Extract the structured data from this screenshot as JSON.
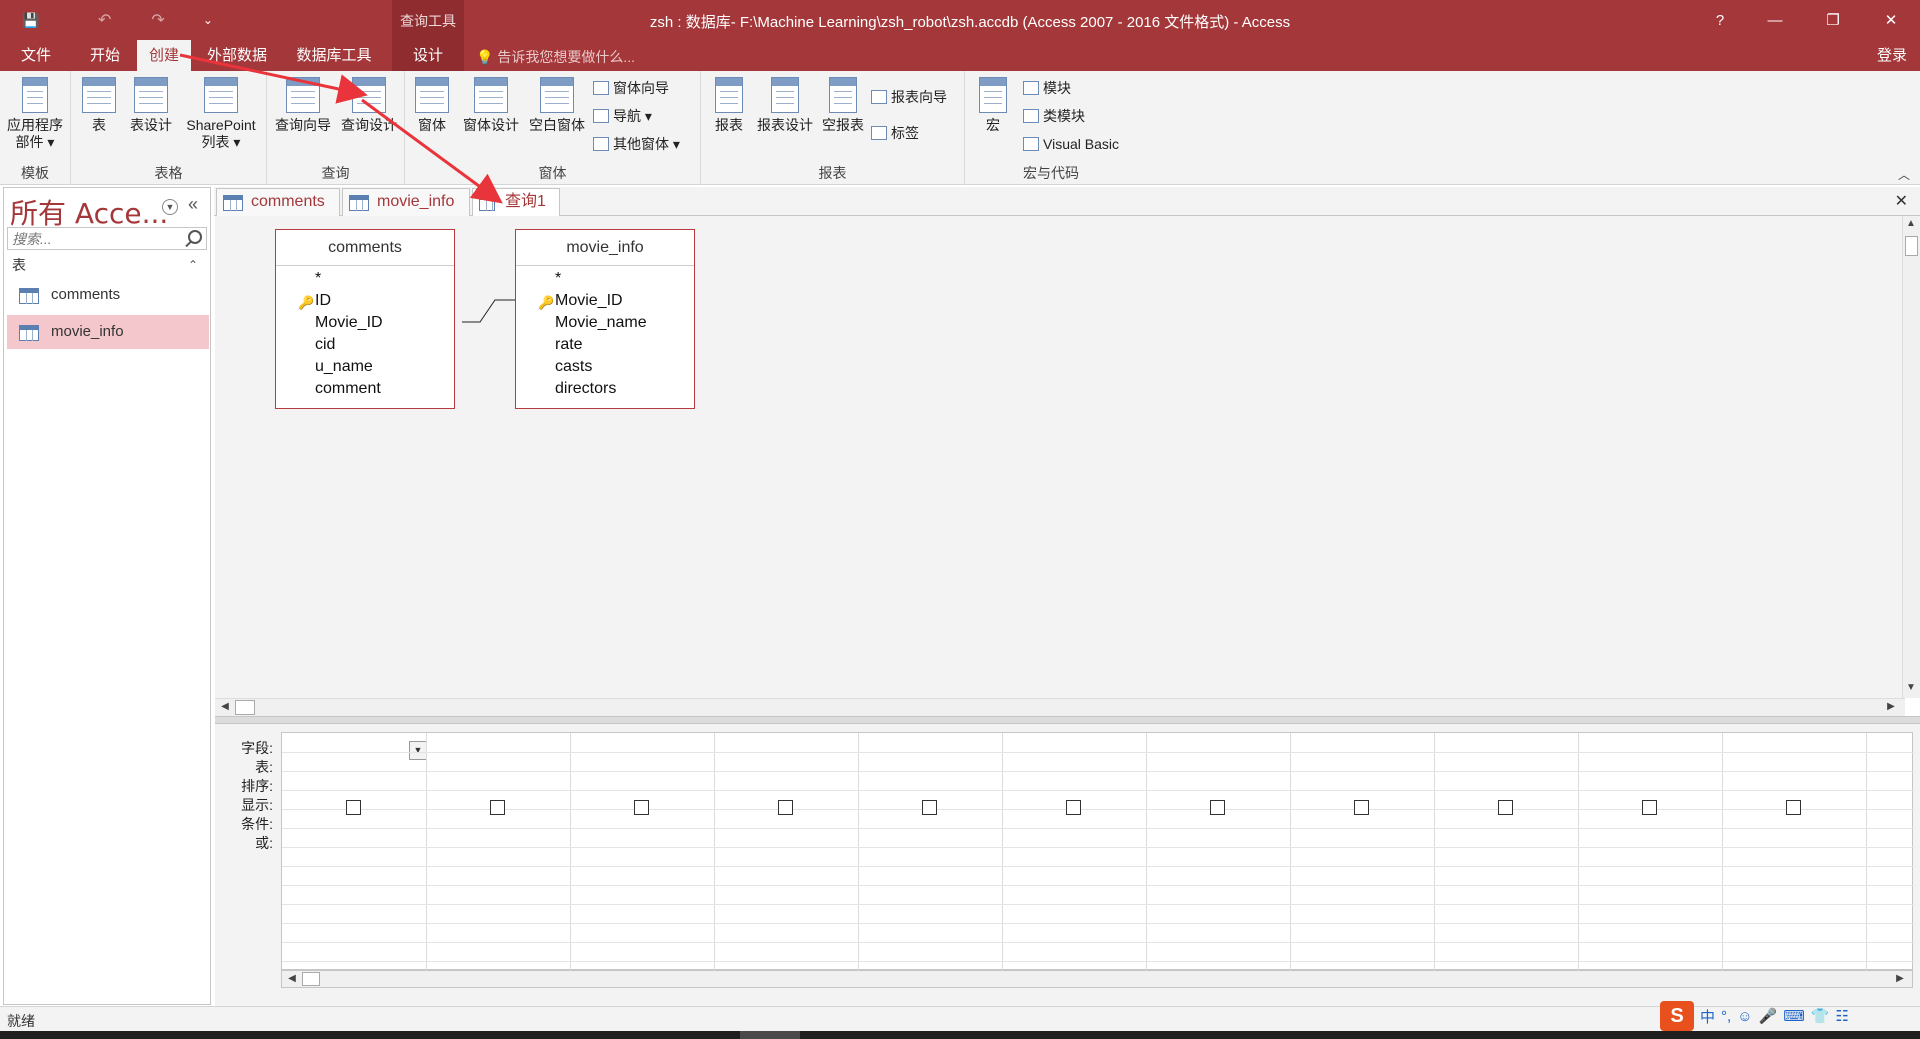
{
  "titlebar": {
    "title": "zsh : 数据库- F:\\Machine Learning\\zsh_robot\\zsh.accdb (Access 2007 - 2016 文件格式) - Access",
    "context_group": "查询工具",
    "help": "?",
    "minimize": "—",
    "restore": "❐",
    "close": "✕",
    "qat": {
      "save": "💾",
      "undo": "↶",
      "redo": "↷",
      "customize": "⌄"
    }
  },
  "tabs": {
    "file": "文件",
    "home": "开始",
    "create": "创建",
    "external": "外部数据",
    "dbtools": "数据库工具",
    "design": "设计",
    "tellme": "告诉我您想要做什么...",
    "signin": "登录"
  },
  "ribbon": {
    "templates": {
      "label": "模板",
      "app_parts_1": "应用程序",
      "app_parts_2": "部件 ▾"
    },
    "tables": {
      "label": "表格",
      "table": "表",
      "table_design": "表设计",
      "sharepoint_1": "SharePoint",
      "sharepoint_2": "列表 ▾"
    },
    "queries": {
      "label": "查询",
      "wizard": "查询向导",
      "design": "查询设计"
    },
    "forms": {
      "label": "窗体",
      "form": "窗体",
      "form_design": "窗体设计",
      "blank_form": "空白窗体",
      "form_wizard": "窗体向导",
      "navigation": "导航 ▾",
      "more_forms": "其他窗体 ▾"
    },
    "reports": {
      "label": "报表",
      "report": "报表",
      "report_design": "报表设计",
      "blank_report": "空报表",
      "report_wizard": "报表向导",
      "labels": "标签"
    },
    "macros": {
      "label": "宏与代码",
      "macro": "宏",
      "module": "模块",
      "class_module": "类模块",
      "vba": "Visual Basic"
    }
  },
  "nav": {
    "title": "所有 Acce...",
    "search_placeholder": "搜索...",
    "group": "表",
    "items": [
      {
        "label": "comments"
      },
      {
        "label": "movie_info"
      }
    ]
  },
  "doc_tabs": [
    {
      "label": "comments"
    },
    {
      "label": "movie_info"
    },
    {
      "label": "查询1"
    }
  ],
  "field_lists": [
    {
      "title": "comments",
      "fields": [
        "*",
        "ID",
        "Movie_ID",
        "cid",
        "u_name",
        "comment"
      ]
    },
    {
      "title": "movie_info",
      "fields": [
        "*",
        "Movie_ID",
        "Movie_name",
        "rate",
        "casts",
        "directors"
      ]
    }
  ],
  "grid": {
    "row_labels": [
      "字段:",
      "表:",
      "排序:",
      "显示:",
      "条件:",
      "或:"
    ],
    "columns": 11
  },
  "status": {
    "text": "就绪"
  },
  "ime": {
    "logo": "S",
    "lang": "中",
    "punct": "°,",
    "emoji": "☺",
    "mic": "🎤",
    "keyboard": "⌨",
    "skin": "👕",
    "tools": "☷"
  },
  "colors": {
    "accent": "#a4373a",
    "arrow": "#e8343a",
    "selected": "#f4c7cc"
  }
}
